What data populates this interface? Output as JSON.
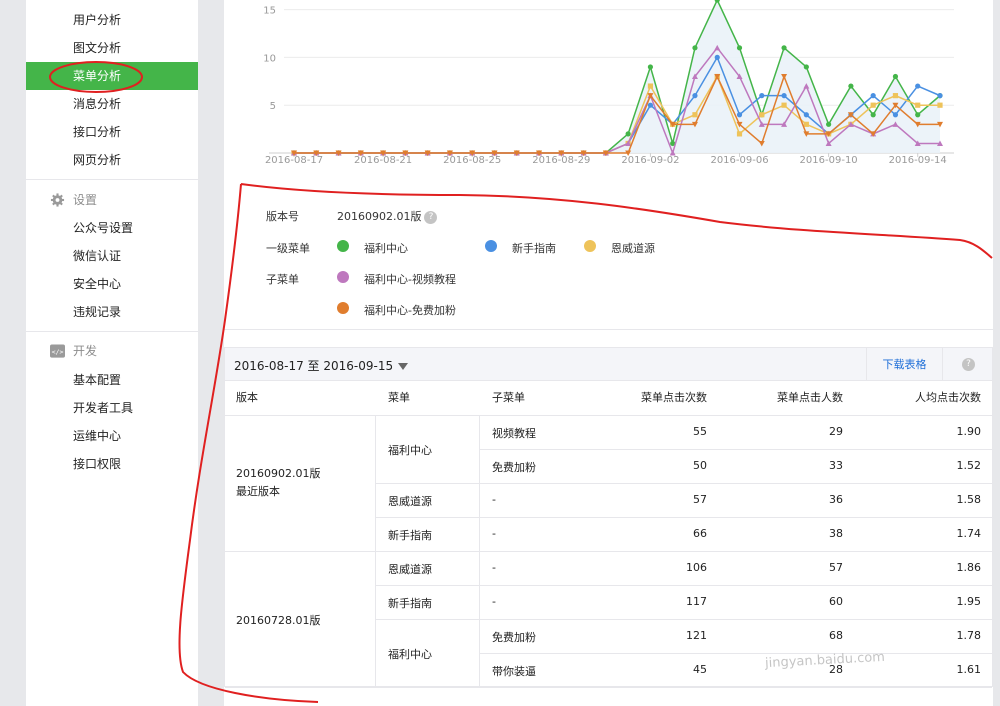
{
  "sidebar": {
    "items": [
      {
        "label": "用户分析"
      },
      {
        "label": "图文分析"
      },
      {
        "label": "菜单分析"
      },
      {
        "label": "消息分析"
      },
      {
        "label": "接口分析"
      },
      {
        "label": "网页分析"
      }
    ],
    "settings": {
      "title": "设置",
      "items": [
        {
          "label": "公众号设置"
        },
        {
          "label": "微信认证"
        },
        {
          "label": "安全中心"
        },
        {
          "label": "违规记录"
        }
      ]
    },
    "dev": {
      "title": "开发",
      "items": [
        {
          "label": "基本配置"
        },
        {
          "label": "开发者工具"
        },
        {
          "label": "运维中心"
        },
        {
          "label": "接口权限"
        }
      ]
    }
  },
  "chart_data": {
    "type": "line",
    "x": [
      "2016-08-17",
      "2016-08-18",
      "2016-08-19",
      "2016-08-20",
      "2016-08-21",
      "2016-08-22",
      "2016-08-23",
      "2016-08-24",
      "2016-08-25",
      "2016-08-26",
      "2016-08-27",
      "2016-08-28",
      "2016-08-29",
      "2016-08-30",
      "2016-08-31",
      "2016-09-01",
      "2016-09-02",
      "2016-09-03",
      "2016-09-04",
      "2016-09-05",
      "2016-09-06",
      "2016-09-07",
      "2016-09-08",
      "2016-09-09",
      "2016-09-10",
      "2016-09-11",
      "2016-09-12",
      "2016-09-13",
      "2016-09-14",
      "2016-09-15"
    ],
    "x_ticks": [
      "2016-08-17",
      "2016-08-21",
      "2016-08-25",
      "2016-08-29",
      "2016-09-02",
      "2016-09-06",
      "2016-09-10",
      "2016-09-14"
    ],
    "y_ticks": [
      "5",
      "10",
      "15"
    ],
    "ylim": [
      0,
      16
    ],
    "series": [
      {
        "name": "福利中心",
        "color": "#44b549",
        "values": [
          0,
          0,
          0,
          0,
          0,
          0,
          0,
          0,
          0,
          0,
          0,
          0,
          0,
          0,
          0,
          2,
          9,
          1,
          11,
          16,
          11,
          4,
          11,
          9,
          3,
          7,
          4,
          8,
          4,
          6
        ]
      },
      {
        "name": "新手指南",
        "color": "#4a90e2",
        "values": [
          0,
          0,
          0,
          0,
          0,
          0,
          0,
          0,
          0,
          0,
          0,
          0,
          0,
          0,
          0,
          1,
          5,
          3,
          6,
          10,
          4,
          6,
          6,
          4,
          2,
          4,
          6,
          4,
          7,
          6
        ]
      },
      {
        "name": "恩威道源",
        "color": "#eec35a",
        "values": [
          0,
          0,
          0,
          0,
          0,
          0,
          0,
          0,
          0,
          0,
          0,
          0,
          0,
          0,
          0,
          1,
          7,
          3,
          4,
          8,
          2,
          4,
          5,
          3,
          2,
          3,
          5,
          6,
          5,
          5
        ]
      },
      {
        "name": "福利中心-视频教程",
        "color": "#be78be",
        "values": [
          0,
          0,
          0,
          0,
          0,
          0,
          0,
          0,
          0,
          0,
          0,
          0,
          0,
          0,
          0,
          1,
          6,
          0,
          8,
          11,
          8,
          3,
          3,
          7,
          1,
          3,
          2,
          3,
          1,
          1
        ]
      },
      {
        "name": "福利中心-免费加粉",
        "color": "#e07d2e",
        "values": [
          0,
          0,
          0,
          0,
          0,
          0,
          0,
          0,
          0,
          0,
          0,
          0,
          0,
          0,
          0,
          0,
          6,
          3,
          3,
          8,
          3,
          1,
          8,
          2,
          2,
          4,
          2,
          5,
          3,
          3
        ]
      }
    ]
  },
  "legend": {
    "version_label": "版本号",
    "version_value": "20160902.01版",
    "level1_label": "一级菜单",
    "level1_items": [
      {
        "name": "福利中心",
        "color": "#44b549"
      },
      {
        "name": "新手指南",
        "color": "#4a90e2"
      },
      {
        "name": "恩威道源",
        "color": "#eec35a"
      }
    ],
    "sub_label": "子菜单",
    "sub_items": [
      {
        "name": "福利中心-视频教程",
        "color": "#be78be"
      },
      {
        "name": "福利中心-免费加粉",
        "color": "#e07d2e"
      }
    ]
  },
  "table": {
    "date_range": "2016-08-17 至 2016-09-15",
    "download_label": "下载表格",
    "help_glyph": "?",
    "headers": [
      "版本",
      "菜单",
      "子菜单",
      "菜单点击次数",
      "菜单点击人数",
      "人均点击次数"
    ],
    "groups": [
      {
        "version": "20160902.01版",
        "version_note": "最近版本",
        "menus": [
          "福利中心",
          "恩威道源",
          "新手指南"
        ],
        "rows": [
          {
            "sub": "视频教程",
            "clicks": "55",
            "users": "29",
            "avg": "1.90"
          },
          {
            "sub": "免费加粉",
            "clicks": "50",
            "users": "33",
            "avg": "1.52"
          },
          {
            "sub": "-",
            "clicks": "57",
            "users": "36",
            "avg": "1.58"
          },
          {
            "sub": "-",
            "clicks": "66",
            "users": "38",
            "avg": "1.74"
          }
        ]
      },
      {
        "version": "20160728.01版",
        "menus": [
          "恩威道源",
          "新手指南",
          "福利中心"
        ],
        "rows": [
          {
            "sub": "-",
            "clicks": "106",
            "users": "57",
            "avg": "1.86"
          },
          {
            "sub": "-",
            "clicks": "117",
            "users": "60",
            "avg": "1.95"
          },
          {
            "sub": "免费加粉",
            "clicks": "121",
            "users": "68",
            "avg": "1.78"
          },
          {
            "sub": "带你装逼",
            "clicks": "45",
            "users": "28",
            "avg": "1.61"
          }
        ]
      }
    ]
  },
  "watermark": {
    "text": "jingyan.baidu.com"
  }
}
